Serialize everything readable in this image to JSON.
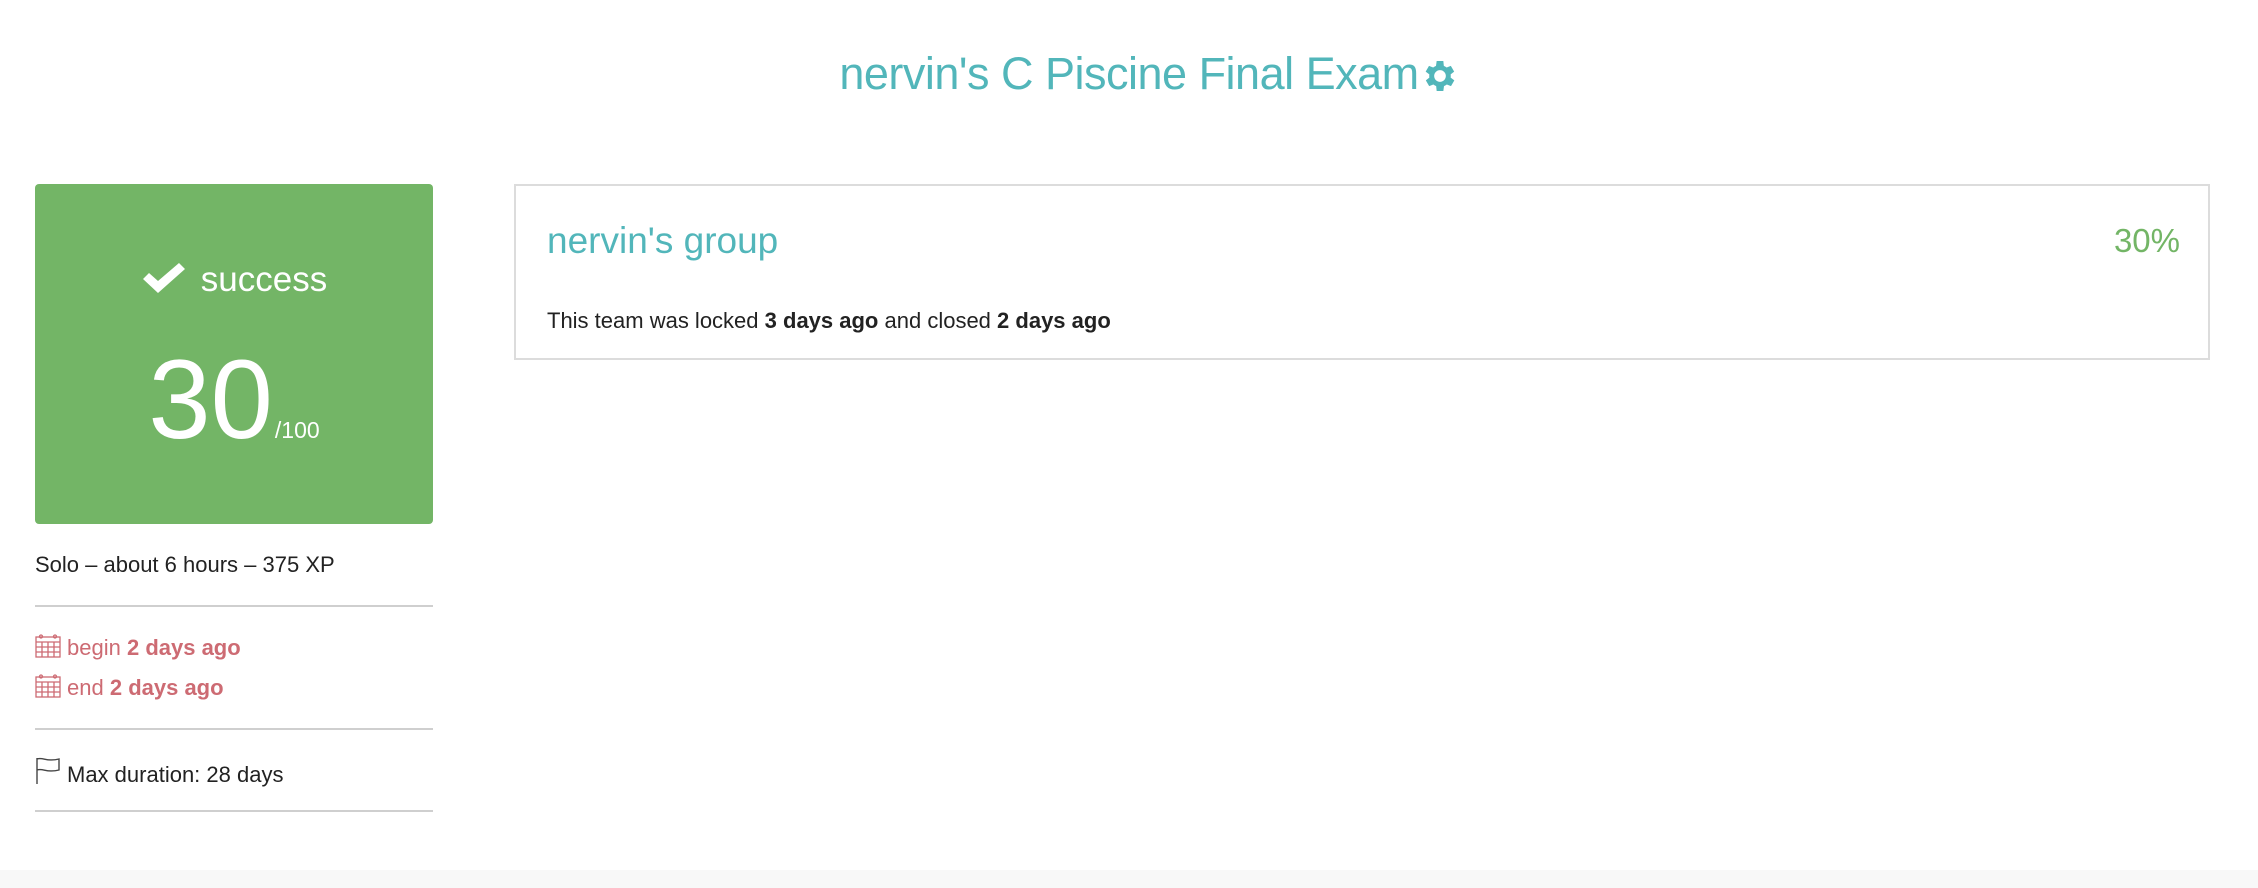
{
  "header": {
    "title": "nervin's C Piscine Final Exam",
    "settings_icon": "gear-icon"
  },
  "result": {
    "status": "success",
    "score": "30",
    "max": "/100",
    "color": "#73b566"
  },
  "meta": {
    "summary": "Solo – about 6 hours – 375 XP",
    "begin_label": "begin",
    "begin_value": "2 days ago",
    "end_label": "end",
    "end_value": "2 days ago",
    "max_duration": "Max duration: 28 days"
  },
  "team": {
    "name": "nervin's group",
    "percent": "30%",
    "info_prefix": "This team was locked",
    "locked": "3 days ago",
    "info_mid": "and closed",
    "closed": "2 days ago"
  },
  "colors": {
    "accent": "#52b6ba",
    "success": "#73b566",
    "date": "#cd6b73"
  }
}
